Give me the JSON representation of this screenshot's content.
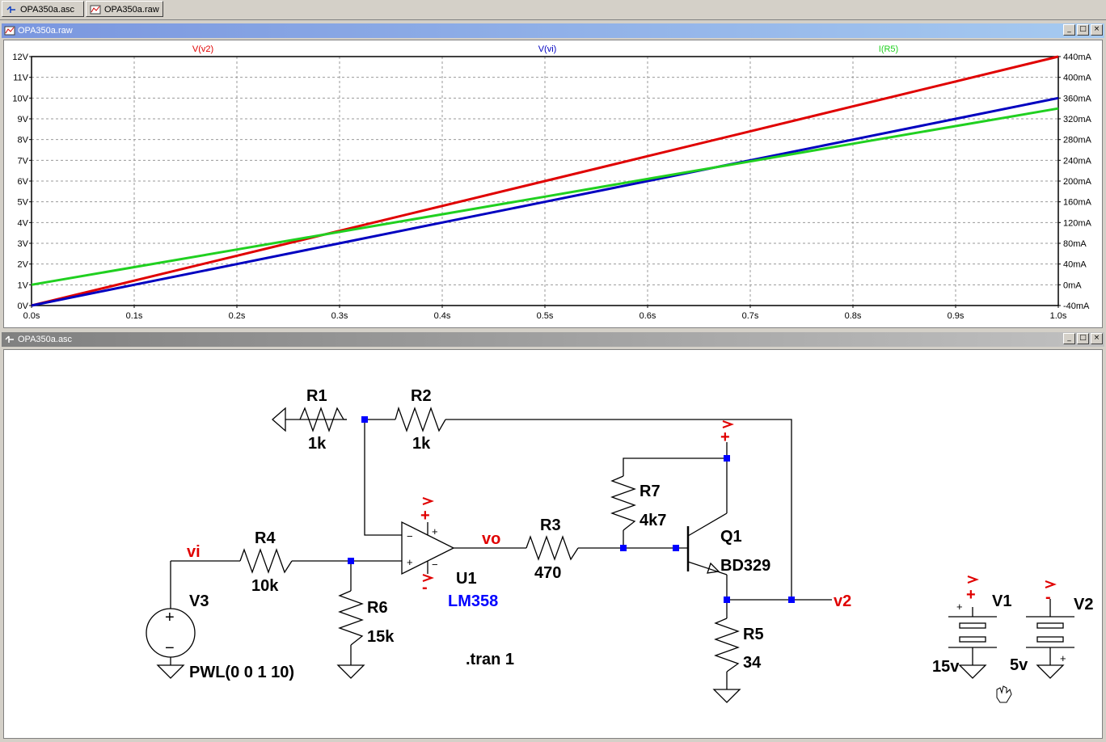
{
  "tabs": [
    {
      "label": "OPA350a.asc",
      "icon": "schematic-icon"
    },
    {
      "label": "OPA350a.raw",
      "icon": "waveform-icon"
    }
  ],
  "waveform_window": {
    "title": "OPA350a.raw",
    "buttons": [
      "_",
      "□",
      "×"
    ]
  },
  "schematic_window": {
    "title": "OPA350a.asc",
    "buttons": [
      "_",
      "□",
      "×"
    ]
  },
  "chart_data": {
    "type": "line",
    "x": [
      0.0,
      0.1,
      0.2,
      0.3,
      0.4,
      0.5,
      0.6,
      0.7,
      0.8,
      0.9,
      1.0
    ],
    "xlim": [
      0,
      1.0
    ],
    "x_ticks": [
      "0.0s",
      "0.1s",
      "0.2s",
      "0.3s",
      "0.4s",
      "0.5s",
      "0.6s",
      "0.7s",
      "0.8s",
      "0.9s",
      "1.0s"
    ],
    "ylim_left": [
      0,
      12
    ],
    "y_ticks_left": [
      "0V",
      "1V",
      "2V",
      "3V",
      "4V",
      "5V",
      "6V",
      "7V",
      "8V",
      "9V",
      "10V",
      "11V",
      "12V"
    ],
    "ylim_right": [
      -40,
      440
    ],
    "y_ticks_right": [
      "-40mA",
      "0mA",
      "40mA",
      "80mA",
      "120mA",
      "160mA",
      "200mA",
      "240mA",
      "280mA",
      "320mA",
      "360mA",
      "400mA",
      "440mA"
    ],
    "grid": true,
    "series": [
      {
        "name": "V(v2)",
        "color": "#e00000",
        "axis": "left",
        "values": [
          0,
          1.2,
          2.4,
          3.6,
          4.8,
          6.0,
          7.2,
          8.4,
          9.6,
          10.8,
          12.0
        ]
      },
      {
        "name": "V(vi)",
        "color": "#0000c0",
        "axis": "left",
        "values": [
          0,
          1.0,
          2.0,
          3.0,
          4.0,
          5.0,
          6.0,
          7.0,
          8.0,
          9.0,
          10.0
        ]
      },
      {
        "name": "I(R5)",
        "color": "#20d020",
        "axis": "right",
        "values": [
          0,
          34,
          68,
          102,
          136,
          170,
          204,
          238,
          272,
          306,
          340
        ]
      }
    ]
  },
  "schematic": {
    "components": {
      "r1": {
        "name": "R1",
        "value": "1k"
      },
      "r2": {
        "name": "R2",
        "value": "1k"
      },
      "r3": {
        "name": "R3",
        "value": "470"
      },
      "r4": {
        "name": "R4",
        "value": "10k"
      },
      "r5": {
        "name": "R5",
        "value": "34"
      },
      "r6": {
        "name": "R6",
        "value": "15k"
      },
      "r7": {
        "name": "R7",
        "value": "4k7"
      },
      "u1": {
        "name": "U1",
        "value": "LM358"
      },
      "q1": {
        "name": "Q1",
        "value": "BD329"
      },
      "v1": {
        "name": "V1",
        "value": "15v"
      },
      "v2": {
        "name": "V2",
        "value": "5v"
      },
      "v3": {
        "name": "V3",
        "value": "PWL(0 0 1 10)"
      }
    },
    "nets": {
      "vi": "vi",
      "vo": "vo",
      "v2": "v2"
    },
    "directive": ".tran 1",
    "supply_labels": {
      "plus_sign": "+",
      "minus_sign": "-"
    },
    "pin_signs": {
      "plus": "+",
      "minus": "−"
    }
  }
}
